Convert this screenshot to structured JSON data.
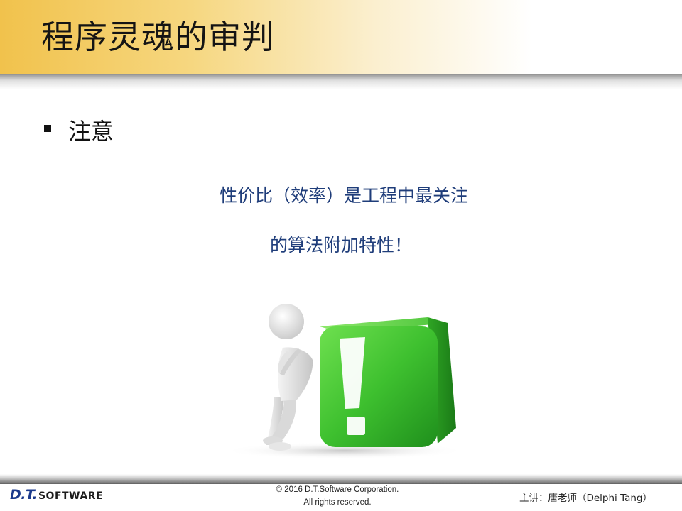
{
  "header": {
    "title": "程序灵魂的审判"
  },
  "bullet": {
    "text": "注意"
  },
  "note": {
    "line1": "性价比（效率）是工程中最关注",
    "line2": "的算法附加特性！"
  },
  "illustration": {
    "icon": "figure-leaning-on-exclamation-block-icon",
    "block_color": "#3ec02f",
    "mark": "!"
  },
  "footer": {
    "logo_dt": "D.T.",
    "logo_software": "SOFTWARE",
    "copyright_line1": "© 2016 D.T.Software Corporation.",
    "copyright_line2": "All rights reserved.",
    "presenter": "主讲：唐老师（Delphi Tang）"
  },
  "colors": {
    "header_gold": "#f1c24c",
    "note_text": "#1f3d7a",
    "logo_blue": "#1b3a8c"
  }
}
